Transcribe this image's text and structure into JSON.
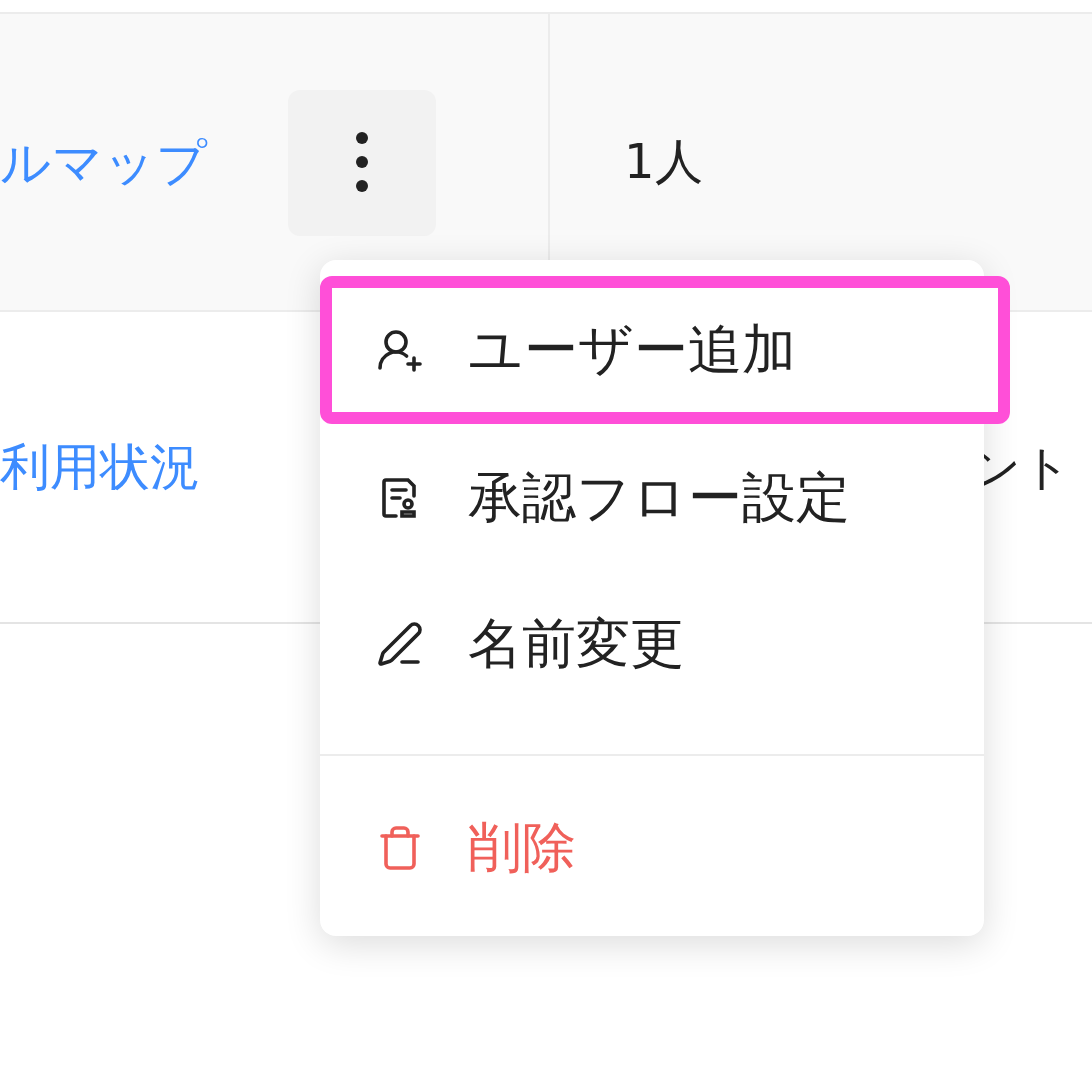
{
  "table": {
    "rows": [
      {
        "name": "ルマップ",
        "cell_2": "1人",
        "hovered": true
      },
      {
        "name": "利用状況",
        "cell_2": "ント",
        "hovered": false
      }
    ]
  },
  "menu": {
    "items": [
      {
        "label": "ユーザー追加",
        "kind": "add-user",
        "selected": true
      },
      {
        "label": "承認フロー設定",
        "kind": "approval",
        "selected": false
      },
      {
        "label": "名前変更",
        "kind": "rename",
        "selected": false
      },
      {
        "label": "削除",
        "kind": "delete",
        "selected": false
      }
    ]
  }
}
